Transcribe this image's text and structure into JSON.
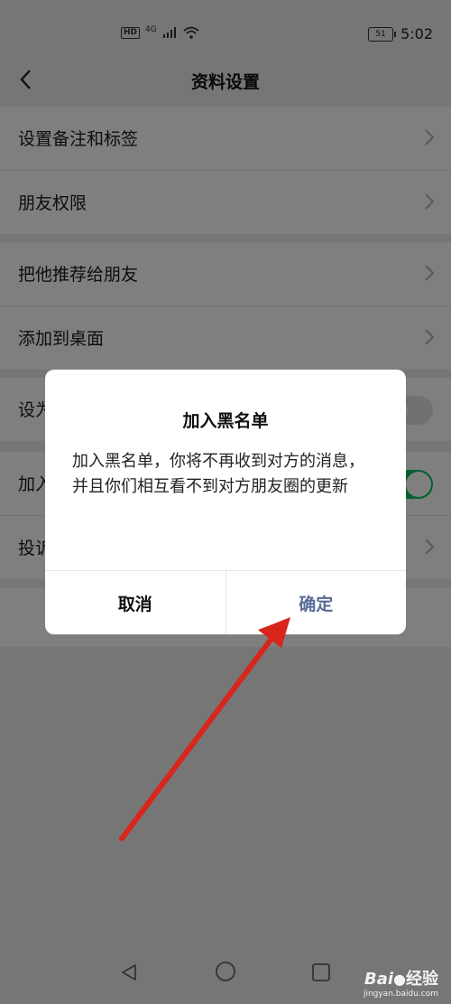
{
  "status_bar": {
    "hd": "HD",
    "network": "4G",
    "battery": "51",
    "time": "5:02"
  },
  "nav": {
    "title": "资料设置"
  },
  "settings": {
    "group1": [
      "设置备注和标签",
      "朋友权限"
    ],
    "group2": [
      "把他推荐给朋友",
      "添加到桌面"
    ],
    "row_star": "设为",
    "row_blacklist": "加入",
    "row_report": "投诉"
  },
  "dialog": {
    "title": "加入黑名单",
    "message": "加入黑名单，你将不再收到对方的消息，并且你们相互看不到对方朋友圈的更新",
    "cancel": "取消",
    "confirm": "确定"
  },
  "watermark": {
    "logo": "Bai",
    "text": "经验",
    "url": "jingyan.baidu.com"
  },
  "colors": {
    "accent_confirm": "#576b95",
    "toggle_on": "#07c160",
    "annotation_arrow": "#d8261c"
  }
}
